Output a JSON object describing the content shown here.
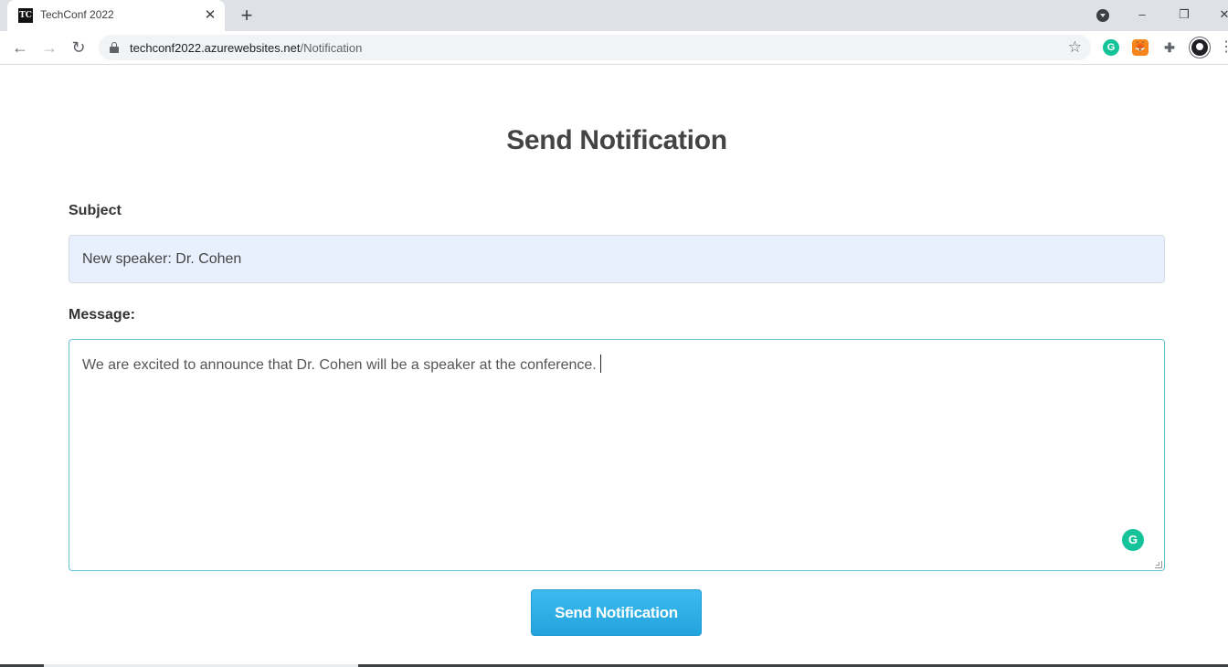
{
  "browser": {
    "tab": {
      "favicon_text": "TC",
      "title": "TechConf 2022",
      "close_icon": "close-icon"
    },
    "new_tab_icon": "plus-icon",
    "window_controls": {
      "minimize": "–",
      "restore": "❐",
      "close": "✕"
    },
    "nav": {
      "back": "←",
      "forward": "→",
      "reload": "↻"
    },
    "address": {
      "host": "techconf2022.azurewebsites.net",
      "path": "/Notification"
    },
    "star_icon": "☆",
    "extensions": {
      "grammarly": "G",
      "fox": "🦊",
      "puzzle": "✚"
    },
    "menu_icon": "⋮"
  },
  "page": {
    "title": "Send Notification",
    "subject_label": "Subject",
    "subject_value": "New speaker: Dr. Cohen",
    "message_label": "Message:",
    "message_value": "We are excited to announce that Dr. Cohen will be a speaker at the conference.",
    "grammarly_badge": "G",
    "submit_label": "Send Notification"
  },
  "colors": {
    "accent": "#2aaae2",
    "input_fill": "#e8f0fe",
    "focus_border": "#66c3cf",
    "grammarly": "#15c39a"
  }
}
